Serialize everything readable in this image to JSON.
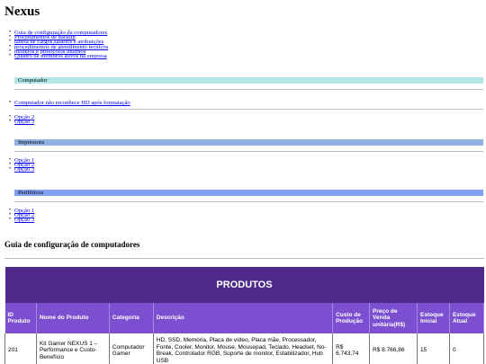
{
  "title": "Nexus",
  "nav_links": [
    "Guia de configuração da computadores",
    "Procedimentos de backup",
    "tabela de cargos,salarios e atribuições",
    "procedimentos de atendimento tecnicos",
    "modelos e protocolos internos",
    "Quadro de membros ativos na empresa"
  ],
  "sections": {
    "computador": {
      "label": "Computador",
      "items": [
        "Computador não reconhece HD após formatação",
        "Opção 2",
        "Opção 3"
      ],
      "color": "#b0e6e6"
    },
    "impressora": {
      "label": "Impressora",
      "items": [
        "Opção 1",
        "Opção 2",
        "Opção 3"
      ],
      "color": "#8fb0e2"
    },
    "perifericos": {
      "label": "Periféricos",
      "items": [
        "Opção 1",
        "Opção 2",
        "Opção 3"
      ],
      "color": "#7f9ff0"
    }
  },
  "guide_heading": "Guia de configuração de computadores",
  "table": {
    "title": "PRODUTOS",
    "columns": [
      "ID Produto",
      "Nome do Produto",
      "Categoria",
      "Descrição",
      "Custo de Produção",
      "Preço de Venda unitária(R$)",
      "Estoque Inicial",
      "Estoque Atual"
    ],
    "rows": [
      {
        "id": "201",
        "name": "Kit Gamer NEXUS 1 – Performance e Custo-Benefício",
        "category": "Computador Gamer",
        "description": "HD, SSD, Memória, Placa de vídeo, Placa mãe, Processador, Fonte, Cooler, Monitor, Mouse, Mousepad, Teclado, Headset, No-Break, Controlador RGB, Suporte de monitor, Estabilizador, Hub USB",
        "cost": "R$ 6.743,74",
        "price": "R$ 8.766,86",
        "stock_initial": "15",
        "stock_current": "0"
      }
    ],
    "header_color": "#4f2a8a",
    "column_header_color": "#7b4fcf"
  }
}
